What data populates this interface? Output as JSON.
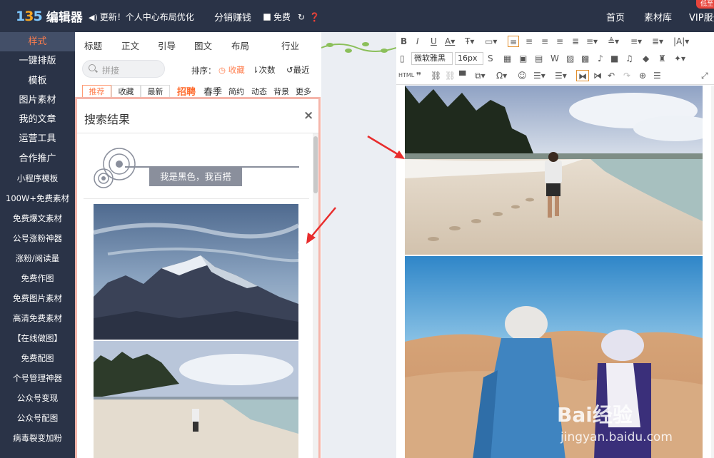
{
  "app": {
    "logo_text": "编辑器",
    "logo_mark": "135",
    "update_text": "更新！个人中心布局优化",
    "fenxiao": "分销赚钱",
    "free": "免费",
    "nav": [
      "首页",
      "素材库",
      "VIP服务"
    ],
    "promo_badge": "低至"
  },
  "sidebar": {
    "items": [
      {
        "label": "样式",
        "active": true
      },
      {
        "label": "一键排版"
      },
      {
        "label": "模板"
      },
      {
        "label": "图片素材"
      },
      {
        "label": "我的文章"
      },
      {
        "label": "运营工具"
      },
      {
        "label": "合作推广"
      },
      {
        "label": "小程序模板"
      },
      {
        "label": "100W+免费素材"
      },
      {
        "label": "免费爆文素材"
      },
      {
        "label": "公号涨粉神器"
      },
      {
        "label": "涨粉/阅读量"
      },
      {
        "label": "免费作图"
      },
      {
        "label": "免费图片素材"
      },
      {
        "label": "高清免费素材"
      },
      {
        "label": "【在线做图】"
      },
      {
        "label": "免费配图"
      },
      {
        "label": "个号管理神器"
      },
      {
        "label": "公众号变现"
      },
      {
        "label": "公众号配图"
      },
      {
        "label": "病毒裂变加粉"
      }
    ]
  },
  "panel": {
    "tabs": [
      "标题",
      "正文",
      "引导",
      "图文",
      "布局",
      "行业"
    ],
    "search_placeholder": "拼接",
    "sort_label": "排序：",
    "sort_options": [
      "收藏",
      "次数",
      "最近"
    ],
    "filters": [
      "推荐",
      "收藏",
      "最新"
    ],
    "tags": [
      "招聘",
      "春季",
      "简约",
      "动态",
      "背景",
      "更多"
    ]
  },
  "result": {
    "title": "搜索结果",
    "close": "×",
    "card_text": "我是黑色，我百搭"
  },
  "editor": {
    "font_family": "微软雅黑",
    "font_size": "16px",
    "html_label": "HTML"
  },
  "watermark": {
    "line1": "Bai经验",
    "line2": "jingyan.baidu.com"
  }
}
